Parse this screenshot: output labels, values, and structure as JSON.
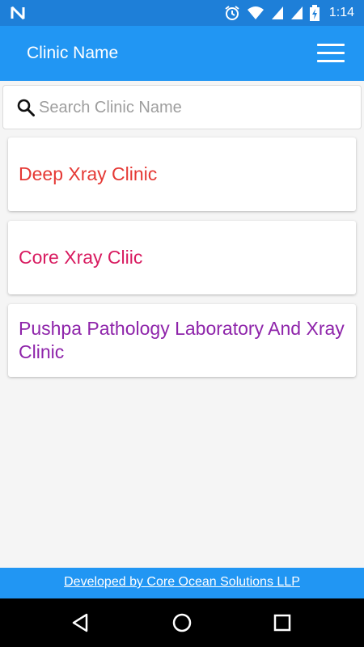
{
  "status_bar": {
    "time": "1:14",
    "icons": [
      "n-logo-icon",
      "alarm-icon",
      "wifi-icon",
      "signal-icon",
      "signal-icon",
      "battery-charging-icon"
    ]
  },
  "app_bar": {
    "title": "Clinic Name",
    "menu_icon": "hamburger-menu-icon"
  },
  "search": {
    "placeholder": "Search Clinic Name",
    "value": "",
    "icon": "search-icon"
  },
  "clinics": [
    {
      "name": "Deep Xray Clinic",
      "color": "#e53935"
    },
    {
      "name": "Core Xray Cliic",
      "color": "#d81b60"
    },
    {
      "name": "Pushpa Pathology Laboratory And Xray Clinic",
      "color": "#8e24aa"
    }
  ],
  "footer": {
    "text": "Developed by Core Ocean Solutions LLP"
  },
  "colors": {
    "primary": "#2196f3",
    "status_bar": "#1e7fd8",
    "background": "#f5f5f5"
  },
  "nav": {
    "icons": [
      "back-icon",
      "home-icon",
      "recents-icon"
    ]
  }
}
